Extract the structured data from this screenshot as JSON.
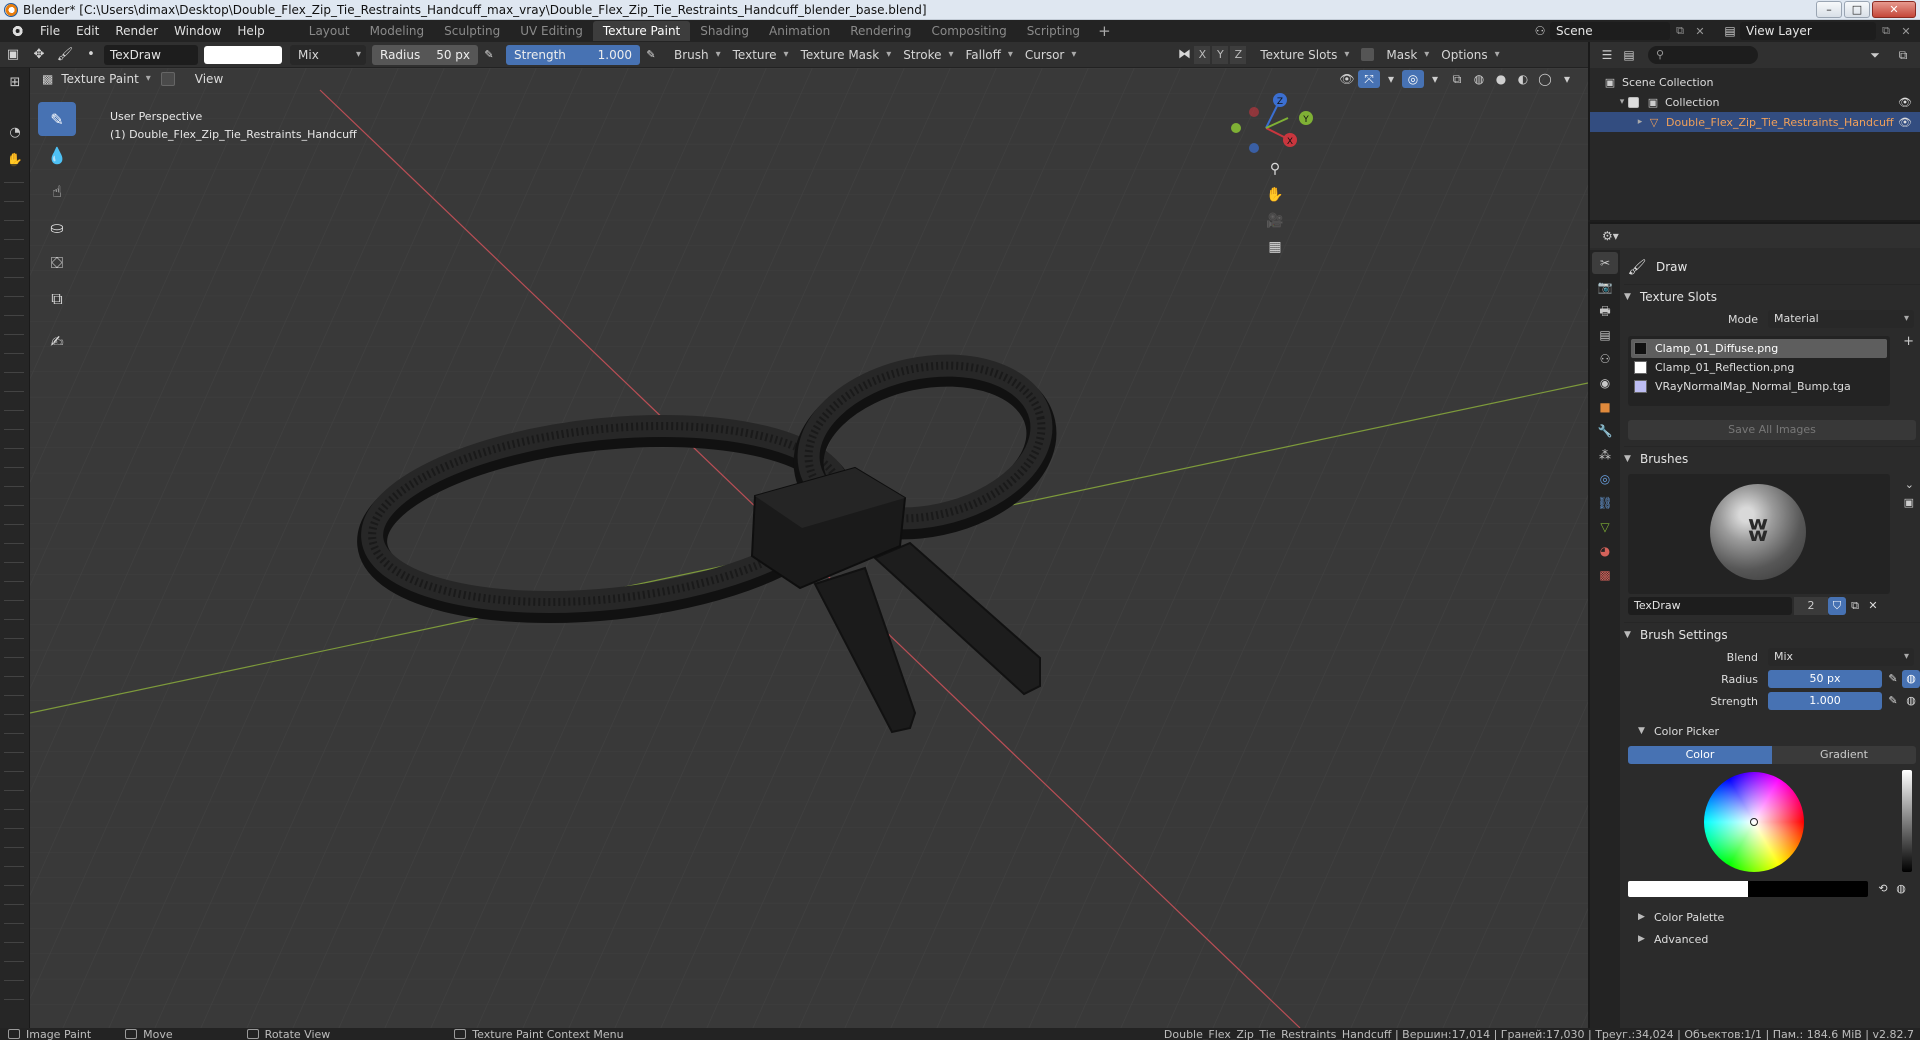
{
  "window": {
    "title": "Blender* [C:\\Users\\dimax\\Desktop\\Double_Flex_Zip_Tie_Restraints_Handcuff_max_vray\\Double_Flex_Zip_Tie_Restraints_Handcuff_blender_base.blend]",
    "buttons": {
      "minimize": "–",
      "maximize": "□",
      "close": "✕"
    }
  },
  "menubar": {
    "items": [
      "File",
      "Edit",
      "Render",
      "Window",
      "Help"
    ],
    "workspaces": [
      "Layout",
      "Modeling",
      "Sculpting",
      "UV Editing",
      "Texture Paint",
      "Shading",
      "Animation",
      "Rendering",
      "Compositing",
      "Scripting"
    ],
    "active_workspace": "Texture Paint",
    "add_tab": "+",
    "scene": "Scene",
    "view_layer": "View Layer"
  },
  "toolheader": {
    "brush_name": "TexDraw",
    "blend": "Mix",
    "radius_label": "Radius",
    "radius_value": "50 px",
    "strength_label": "Strength",
    "strength_value": "1.000",
    "menus": [
      "Brush",
      "Texture",
      "Texture Mask",
      "Stroke",
      "Falloff",
      "Cursor"
    ],
    "axes": [
      "X",
      "Y",
      "Z"
    ],
    "texture_slots": "Texture Slots",
    "mask": "Mask",
    "options": "Options"
  },
  "viewport": {
    "mode": "Texture Paint",
    "view_menu": "View",
    "perspective": "User Perspective",
    "object_info": "(1) Double_Flex_Zip_Tie_Restraints_Handcuff",
    "gizmo": {
      "x": "X",
      "y": "Y",
      "z": "Z"
    }
  },
  "outliner": {
    "rows": [
      {
        "label": "Scene Collection"
      },
      {
        "label": "Collection"
      },
      {
        "label": "Double_Flex_Zip_Tie_Restraints_Handcuff"
      }
    ]
  },
  "properties": {
    "tool_name": "Draw",
    "texture_slots": {
      "title": "Texture Slots",
      "mode_label": "Mode",
      "mode_value": "Material",
      "slots": [
        {
          "name": "Clamp_01_Diffuse.png",
          "color": "#111111"
        },
        {
          "name": "Clamp_01_Reflection.png",
          "color": "#ffffff"
        },
        {
          "name": "VRayNormalMap_Normal_Bump.tga",
          "color": "#bdbdf2"
        }
      ],
      "save_all": "Save All Images"
    },
    "brushes": {
      "title": "Brushes",
      "brush_name": "TexDraw",
      "users": "2"
    },
    "brush_settings": {
      "title": "Brush Settings",
      "blend_label": "Blend",
      "blend_value": "Mix",
      "radius_label": "Radius",
      "radius_value": "50 px",
      "strength_label": "Strength",
      "strength_value": "1.000"
    },
    "color_picker": {
      "title": "Color Picker",
      "tab_color": "Color",
      "tab_gradient": "Gradient"
    },
    "color_palette": "Color Palette",
    "advanced": "Advanced"
  },
  "statusbar": {
    "items": [
      "Image Paint",
      "Move",
      "Rotate View",
      "Texture Paint Context Menu"
    ],
    "stats": "Double_Flex_Zip_Tie_Restraints_Handcuff | Вершин:17,014 | Граней:17,030 | Треуг.:34,024 | Объектов:1/1 | Пам.: 184.6 MiB | v2.82.7"
  },
  "colors": {
    "accent": "#4772b3",
    "selected_object": "#f0a05a",
    "viewport_bg": "#393939",
    "object": "#1e1e1e"
  }
}
